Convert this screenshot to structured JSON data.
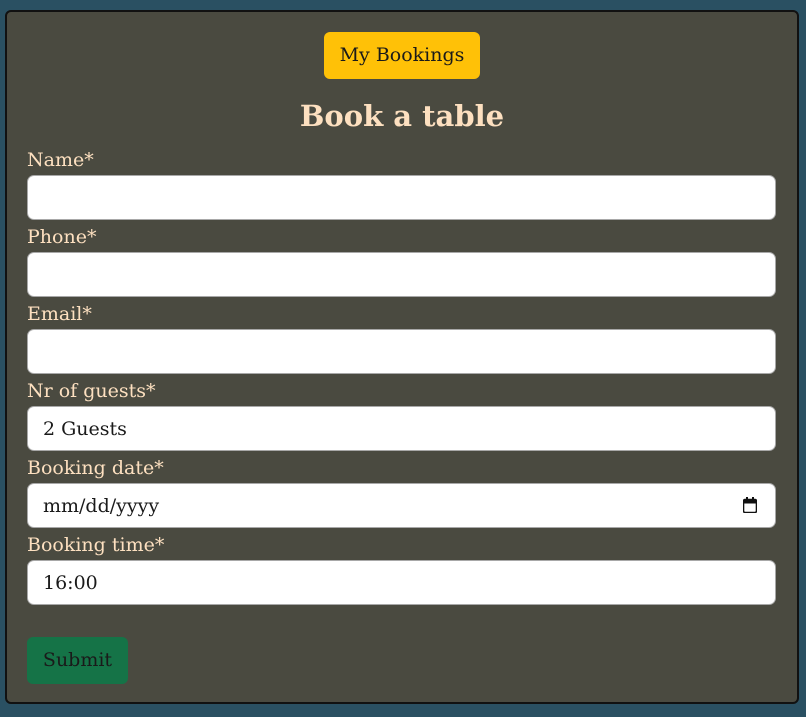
{
  "header": {
    "my_bookings_label": "My Bookings",
    "title": "Book a table"
  },
  "form": {
    "fields": [
      {
        "label": "Name*",
        "value": ""
      },
      {
        "label": "Phone*",
        "value": ""
      },
      {
        "label": "Email*",
        "value": ""
      },
      {
        "label": "Nr of guests*",
        "value": "2 Guests"
      },
      {
        "label": "Booking date*",
        "value": "mm/dd/yyyy"
      },
      {
        "label": "Booking time*",
        "value": "16:00"
      }
    ],
    "submit_label": "Submit"
  },
  "colors": {
    "page_background": "#2a5062",
    "card_background": "#4a4a40",
    "label_text": "#fde0c0",
    "my_bookings_button": "#ffc107",
    "submit_button": "#157347"
  },
  "icons": {
    "date_picker": "calendar-icon"
  }
}
